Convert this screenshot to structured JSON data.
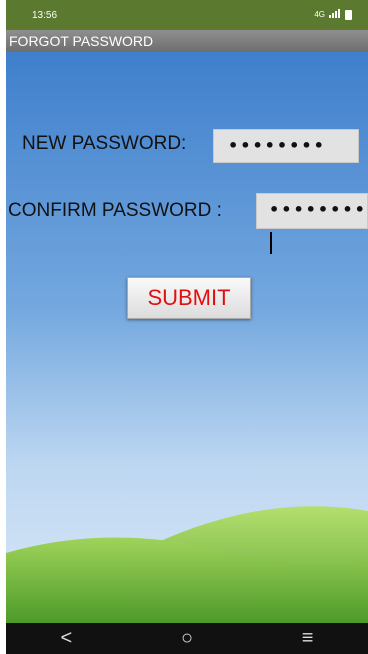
{
  "status": {
    "time": "13:56",
    "network": "4G"
  },
  "title": "FORGOT PASSWORD",
  "form": {
    "new_password_label": "NEW PASSWORD:",
    "new_password_value": "••••••••",
    "confirm_password_label": "CONFIRM PASSWORD :",
    "confirm_password_value": "••••••••",
    "submit_label": "SUBMIT"
  },
  "nav": {
    "back": "<",
    "home": "○",
    "menu": "≡"
  },
  "icons": [
    "signal-icon",
    "battery-icon",
    "back-icon",
    "home-icon",
    "menu-icon"
  ],
  "colors": {
    "status_bar": "#5b7a2f",
    "title_bar": "#7f7f7f",
    "sky": "#4f8fd6",
    "submit_text": "#e01010"
  }
}
